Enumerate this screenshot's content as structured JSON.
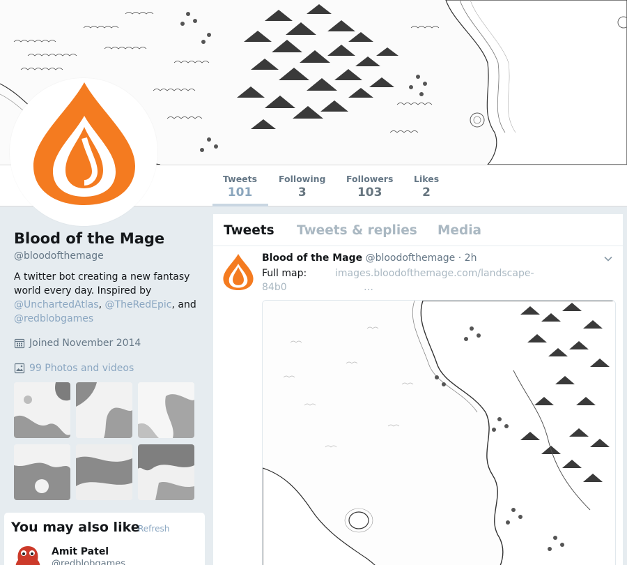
{
  "profile": {
    "name": "Blood of the Mage",
    "handle": "@bloodofthemage",
    "bio_text_1": "A twitter bot creating a new fantasy world every day. Inspired by",
    "bio_link_1": "@UnchartedAtlas",
    "bio_sep_1": ",",
    "bio_link_2": "@TheRedEpic",
    "bio_sep_2": ",",
    "bio_text_2": "and",
    "bio_link_3": "@redblobgames",
    "joined": "Joined November 2014",
    "photos_label": "99 Photos and videos"
  },
  "stats": [
    {
      "label": "Tweets",
      "value": "101"
    },
    {
      "label": "Following",
      "value": "3"
    },
    {
      "label": "Followers",
      "value": "103"
    },
    {
      "label": "Likes",
      "value": "2"
    }
  ],
  "tabs": [
    "Tweets",
    "Tweets & replies",
    "Media"
  ],
  "tweet": {
    "name": "Blood of the Mage",
    "handle": "@bloodofthemage",
    "dot": "·",
    "time": "2h",
    "prefix": "Full map:",
    "url_line_1": "images.bloodofthemage.com/landscape-",
    "url_line_2": "84b0",
    "ellipsis": "…"
  },
  "suggestions": {
    "title": "You may also like",
    "dot": "·",
    "refresh": "Refresh",
    "user_name": "Amit Patel",
    "user_handle": "@redblobgames"
  },
  "colors": {
    "brand_orange": "#f47b20",
    "link": "#8aa6c1",
    "background": "#e6ecf0"
  },
  "icons": [
    "calendar-icon",
    "photo-icon",
    "chevron-down-icon",
    "flame-logo"
  ]
}
